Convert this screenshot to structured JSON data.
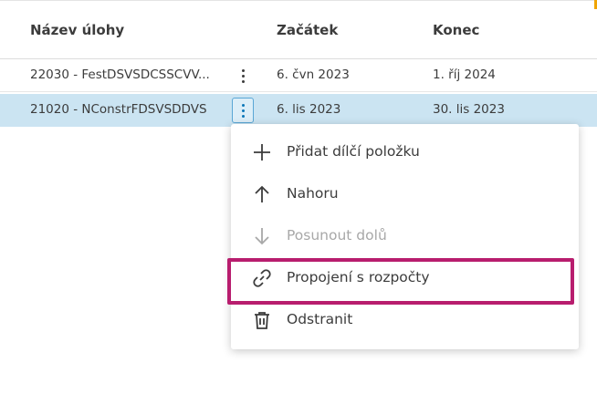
{
  "table": {
    "columns": [
      "Název úlohy",
      "Začátek",
      "Konec"
    ],
    "rows": [
      {
        "name": "22030 - FestDSVSDCSSCVV...",
        "start": "6. čvn 2023",
        "end": "1. říj 2024"
      },
      {
        "name": "21020 - NConstrFDSVSDDVS",
        "start": "6. lis 2023",
        "end": "30. lis 2023"
      }
    ]
  },
  "context_menu": {
    "items": [
      {
        "label": "Přidat dílčí položku",
        "icon": "plus-icon",
        "disabled": false
      },
      {
        "label": "Nahoru",
        "icon": "arrow-up-icon",
        "disabled": false
      },
      {
        "label": "Posunout dolů",
        "icon": "arrow-down-icon",
        "disabled": true
      },
      {
        "label": "Propojení s rozpočty",
        "icon": "link-icon",
        "disabled": false
      },
      {
        "label": "Odstranit",
        "icon": "trash-icon",
        "disabled": false
      }
    ]
  },
  "colors": {
    "selected_row": "#cbe4f2",
    "highlight_border": "#b81d6e",
    "text": "#3c3c3c",
    "disabled_text": "#a8a8a8"
  }
}
